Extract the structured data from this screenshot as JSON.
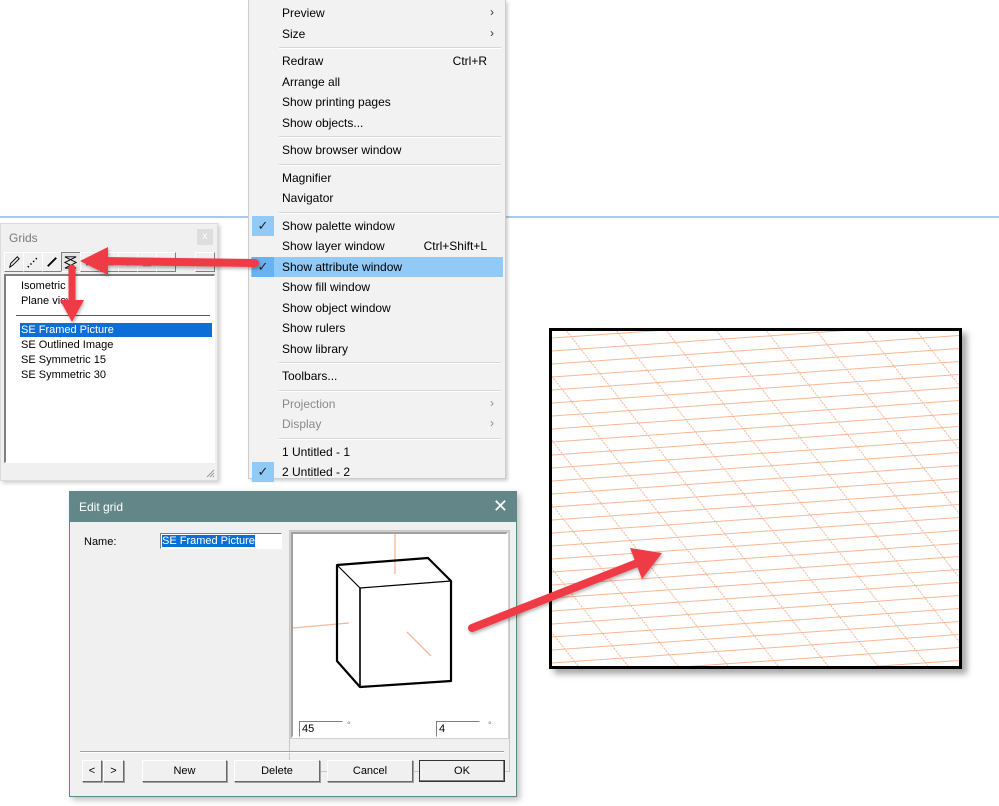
{
  "menu": {
    "items": [
      {
        "label": "Preview",
        "submenu": true
      },
      {
        "label": "Size",
        "submenu": true
      },
      {
        "separator": true
      },
      {
        "label": "Redraw",
        "shortcut": "Ctrl+R"
      },
      {
        "label": "Arrange all"
      },
      {
        "label": "Show printing pages"
      },
      {
        "label": "Show objects..."
      },
      {
        "separator": true
      },
      {
        "label": "Show browser window"
      },
      {
        "separator": true
      },
      {
        "label": "Magnifier"
      },
      {
        "label": "Navigator"
      },
      {
        "separator": true
      },
      {
        "label": "Show palette window",
        "checked": true
      },
      {
        "label": "Show layer window",
        "shortcut": "Ctrl+Shift+L"
      },
      {
        "label": "Show attribute window",
        "checked": true,
        "highlighted": true
      },
      {
        "label": "Show fill window"
      },
      {
        "label": "Show object window"
      },
      {
        "label": "Show rulers"
      },
      {
        "label": "Show library"
      },
      {
        "separator": true
      },
      {
        "label": "Toolbars..."
      },
      {
        "separator": true
      },
      {
        "label": "Projection",
        "submenu": true,
        "disabled": true
      },
      {
        "label": "Display",
        "submenu": true,
        "disabled": true
      },
      {
        "separator": true
      },
      {
        "label": "1 Untitled - 1"
      },
      {
        "label": "2 Untitled - 2",
        "checked": true
      }
    ],
    "check_glyph": "✓",
    "submenu_glyph": "›"
  },
  "grids_panel": {
    "title": "Grids",
    "close_glyph": "x",
    "toolbar": [
      {
        "icon": "pencil-icon"
      },
      {
        "icon": "dotted-line-icon"
      },
      {
        "icon": "line-icon"
      },
      {
        "icon": "grid-isometric-icon",
        "pressed": true
      },
      {
        "icon": "tool-5-icon"
      },
      {
        "icon": "tool-6-icon"
      },
      {
        "icon": "tool-7-icon"
      },
      {
        "icon": "tool-8-icon"
      },
      {
        "icon": "tool-9-icon"
      },
      {
        "icon": "tool-10-icon"
      }
    ],
    "list_top": [
      "Isometric",
      "Plane view"
    ],
    "list_bottom": [
      "SE Framed Picture",
      "SE Outlined Image",
      "SE Symmetric 15",
      "SE Symmetric 30"
    ],
    "selected": "SE Framed Picture"
  },
  "edit_grid": {
    "title": "Edit grid",
    "close_glyph": "✕",
    "name_label": "Name:",
    "name_value": "SE Framed Picture",
    "angle_value": "45",
    "angle_unit": "°",
    "tilt_value": "4",
    "tilt_unit": "°",
    "buttons": {
      "prev": "<",
      "next": ">",
      "new": "New",
      "delete": "Delete",
      "cancel": "Cancel",
      "ok": "OK"
    }
  },
  "colors": {
    "grid_line": "#f7b796",
    "menu_highlight": "#91c9f7",
    "list_selection": "#0b6fd6",
    "dialog_titlebar": "#638788",
    "annotation_arrow": "#ee3b44"
  }
}
